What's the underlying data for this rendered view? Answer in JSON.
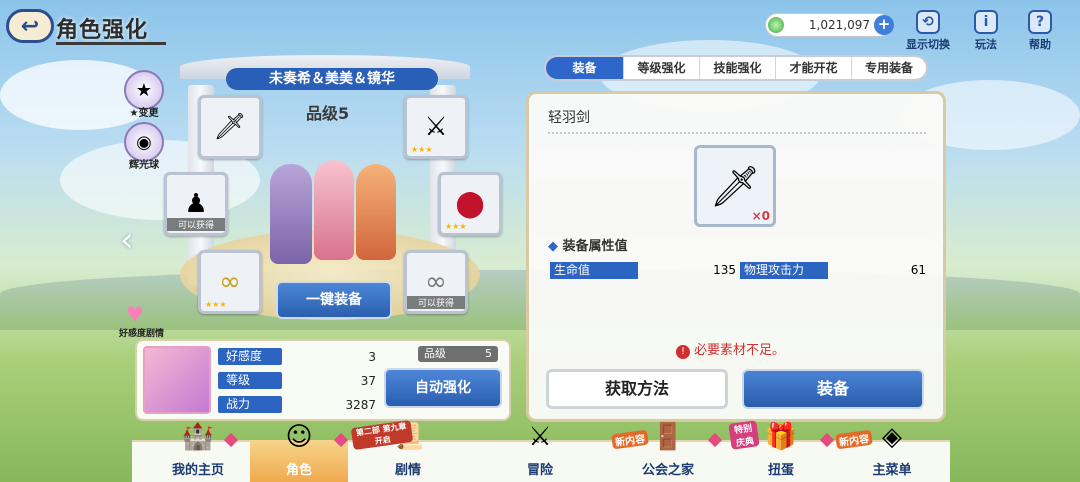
{
  "header": {
    "title": "角色强化",
    "currency": "1,021,097",
    "display_toggle": "显示切换",
    "howto": "玩法",
    "help": "帮助"
  },
  "tabs": [
    "装备",
    "等级强化",
    "技能强化",
    "才能开花",
    "专用装备"
  ],
  "character": {
    "name": "未奏希＆美美＆镜华",
    "rank_label": "品级5"
  },
  "side": {
    "star_change": "★变更",
    "orb": "辉光球",
    "affection_story": "好感度剧情"
  },
  "slots": [
    {
      "icon": "sword-icon",
      "obtainable": ""
    },
    {
      "icon": "claw-icon",
      "obtainable": ""
    },
    {
      "icon": "statue-icon",
      "obtainable": "可以获得"
    },
    {
      "icon": "gem-icon",
      "obtainable": ""
    },
    {
      "icon": "earring-icon",
      "obtainable": ""
    },
    {
      "icon": "earring-icon",
      "obtainable": "可以获得"
    }
  ],
  "equip_all": "一键装备",
  "stats": {
    "affection_label": "好感度",
    "affection_value": "3",
    "level_label": "等级",
    "level_value": "37",
    "power_label": "战力",
    "power_value": "3287",
    "rank_label": "品级",
    "rank_value": "5"
  },
  "auto_enhance": "自动强化",
  "detail": {
    "item_name": "轻羽剑",
    "quantity": "×0",
    "attr_title": "装备属性值",
    "attrs": [
      {
        "name": "生命值",
        "value": "135"
      },
      {
        "name": "物理攻击力",
        "value": "61"
      }
    ],
    "warning": "必要素材不足。",
    "obtain_button": "获取方法",
    "equip_button": "装备"
  },
  "nav": {
    "items": [
      {
        "label": "我的主页"
      },
      {
        "label": "角色"
      },
      {
        "label": "剧情"
      },
      {
        "label": "冒险"
      },
      {
        "label": "公会之家"
      },
      {
        "label": "扭蛋"
      },
      {
        "label": "主菜单"
      }
    ],
    "badge_new1": "新内容",
    "badge_event": "特别庆典",
    "badge_new2": "新内容",
    "badge_part": "第二部 第九章开启"
  }
}
